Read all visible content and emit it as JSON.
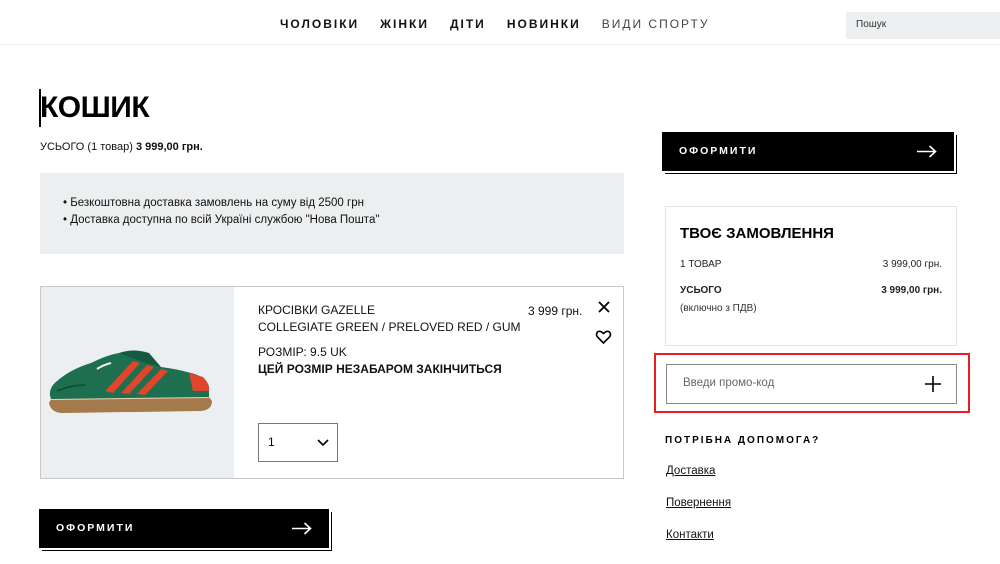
{
  "nav": {
    "items": [
      {
        "label": "ЧОЛОВІКИ"
      },
      {
        "label": "ЖІНКИ"
      },
      {
        "label": "ДІТИ"
      },
      {
        "label": "НОВИНКИ"
      },
      {
        "label": "ВИДИ СПОРТУ"
      }
    ],
    "search_placeholder": "Пошук"
  },
  "cart": {
    "title": "КОШИК",
    "total_prefix": "УСЬОГО (1 товар)",
    "total_amount": "3 999,00 грн."
  },
  "info": {
    "items": [
      "• Безкоштовна доставка замовлень на суму від 2500 грн",
      "• Доставка доступна по всій Україні службою \"Нова Пошта\""
    ]
  },
  "product": {
    "name_line1": "КРОСІВКИ GAZELLE",
    "name_line2": "COLLEGIATE GREEN / PRELOVED RED / GUM",
    "price": "3 999 грн.",
    "size": "РОЗМІР: 9.5 UK",
    "size_warning": "ЦЕЙ РОЗМІР НЕЗАБАРОМ ЗАКІНЧИТЬСЯ",
    "quantity": "1",
    "close_icon": "close-icon",
    "wishlist_icon": "heart-icon",
    "shoe_colors": {
      "upper": "#1e6f4f",
      "stripes": "#e0462b",
      "sole": "#a4794b"
    }
  },
  "checkout": {
    "label": "ОФОРМИТИ",
    "arrow_icon": "arrow-right-icon"
  },
  "order": {
    "title": "ТВОЄ ЗАМОВЛЕННЯ",
    "items_label": "1 ТОВАР",
    "items_value": "3 999,00 грн.",
    "total_label": "УСЬОГО",
    "total_value": "3 999,00 грн.",
    "vat_note": "(включно з ПДВ)"
  },
  "promo": {
    "placeholder": "Введи промо-код",
    "highlight_color": "#ec1c24"
  },
  "help": {
    "title": "ПОТРІБНА ДОПОМОГА?",
    "links": [
      "Доставка",
      "Повернення",
      "Контакти"
    ]
  }
}
